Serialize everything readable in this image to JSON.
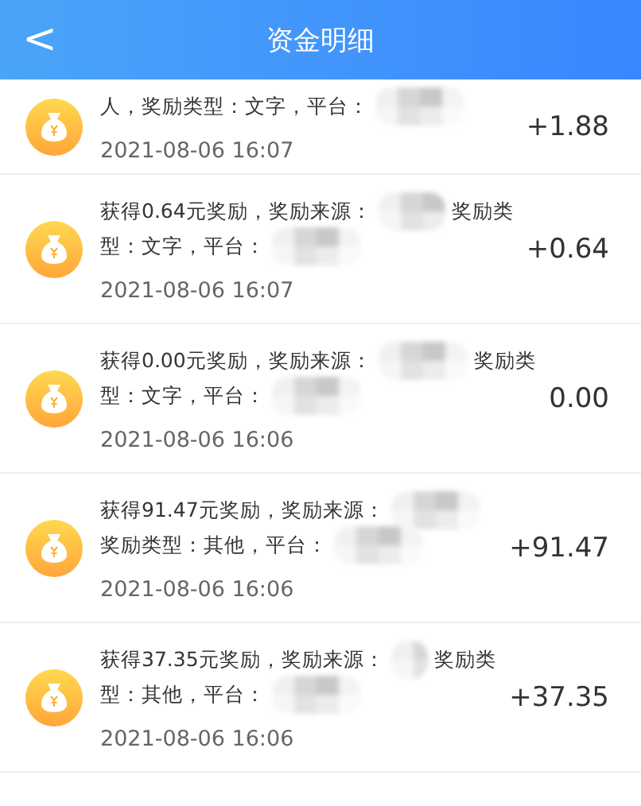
{
  "header": {
    "back": "<",
    "title": "资金明细"
  },
  "records": [
    {
      "lines": [
        [
          {
            "kind": "text",
            "text": "人，奖励类型：文字，平台："
          },
          {
            "kind": "blur"
          }
        ]
      ],
      "time": "2021-08-06 16:07",
      "amount": "+1.88"
    },
    {
      "lines": [
        [
          {
            "kind": "text",
            "text": "获得0.64元奖励，奖励来源："
          },
          {
            "kind": "blur"
          },
          {
            "kind": "text",
            "text": "奖励类"
          }
        ],
        [
          {
            "kind": "text",
            "text": "型：文字，平台："
          },
          {
            "kind": "blur"
          }
        ]
      ],
      "time": "2021-08-06 16:07",
      "amount": "+0.64"
    },
    {
      "lines": [
        [
          {
            "kind": "text",
            "text": "获得0.00元奖励，奖励来源："
          },
          {
            "kind": "blur"
          },
          {
            "kind": "text",
            "text": "奖励类"
          }
        ],
        [
          {
            "kind": "text",
            "text": "型：文字，平台："
          },
          {
            "kind": "blur"
          }
        ]
      ],
      "time": "2021-08-06 16:06",
      "amount": "0.00"
    },
    {
      "lines": [
        [
          {
            "kind": "text",
            "text": "获得91.47元奖励，奖励来源："
          },
          {
            "kind": "blur"
          }
        ],
        [
          {
            "kind": "text",
            "text": "奖励类型：其他，平台："
          },
          {
            "kind": "blur"
          }
        ]
      ],
      "time": "2021-08-06 16:06",
      "amount": "+91.47"
    },
    {
      "lines": [
        [
          {
            "kind": "text",
            "text": "获得37.35元奖励，奖励来源："
          },
          {
            "kind": "blur"
          },
          {
            "kind": "text",
            "text": "奖励类"
          }
        ],
        [
          {
            "kind": "text",
            "text": "型：其他，平台："
          },
          {
            "kind": "blur"
          }
        ]
      ],
      "time": "2021-08-06 16:06",
      "amount": "+37.35"
    }
  ]
}
